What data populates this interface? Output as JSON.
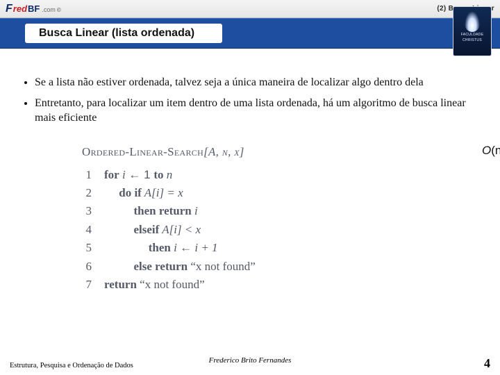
{
  "brand": {
    "f": "F",
    "red": "red",
    "bf": "BF",
    "ext": ".com",
    "reg": "©"
  },
  "header": {
    "right": "(2) Busca Linear"
  },
  "title": "Busca Linear (lista ordenada)",
  "badge": {
    "line1": "FACULDADE",
    "line2": "CHRISTUS"
  },
  "bullets": [
    "Se a lista não estiver ordenada, talvez seja a única maneira de localizar algo dentro dela",
    "Entretanto, para localizar um item dentro de uma lista ordenada, há um algoritmo de busca linear mais eficiente"
  ],
  "algo": {
    "name": "Ordered-Linear-Search",
    "args": "[A, n, x]",
    "lines": {
      "l1_num": "1",
      "l1_for": "for",
      "l1_var": "i",
      "l1_arrow": " ← 1 ",
      "l1_to": "to",
      "l1_n": " n",
      "l2_num": "2",
      "l2_doif": "do if",
      "l2_expr": " A[i] = x",
      "l3_num": "3",
      "l3_then": "then return",
      "l3_var": " i",
      "l4_num": "4",
      "l4_elseif": "elseif",
      "l4_expr": " A[i] < x",
      "l5_num": "5",
      "l5_then": "then",
      "l5_rest": " i ← i + 1",
      "l6_num": "6",
      "l6_else": "else return",
      "l6_msg": " “x not found”",
      "l7_num": "7",
      "l7_return": "return",
      "l7_msg": " “x not found”"
    },
    "complexity_o": "O",
    "complexity_arg": "(n)"
  },
  "footer": {
    "left": "Estrutura, Pesquisa e Ordenação de Dados",
    "center": "Frederico Brito Fernandes",
    "page": "4"
  }
}
